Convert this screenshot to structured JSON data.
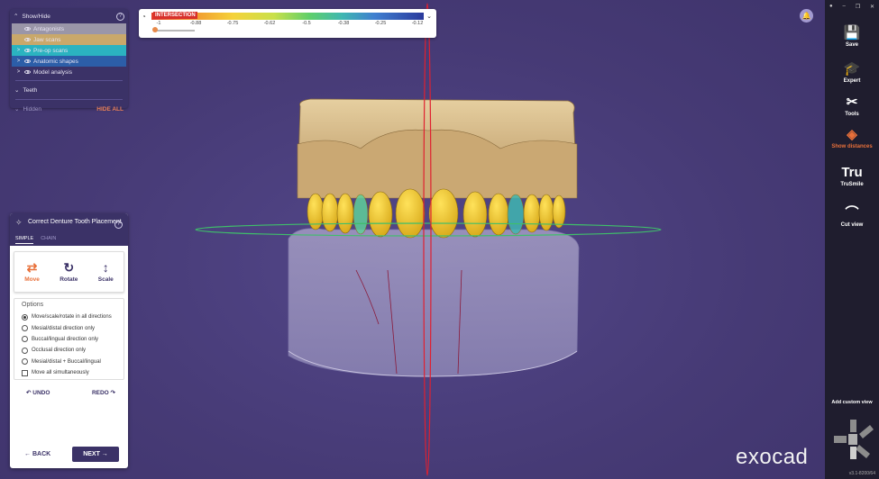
{
  "show_hide": {
    "title": "Show/Hide",
    "layers": [
      {
        "label": "Antagonists",
        "bg": "#9a96a8",
        "chevron": ""
      },
      {
        "label": "Jaw scans",
        "bg": "#c9a86a",
        "chevron": ""
      },
      {
        "label": "Pre-op scans",
        "bg": "#2bb3c0",
        "chevron": ">"
      },
      {
        "label": "Anatomic shapes",
        "bg": "#2c5ea8",
        "chevron": ">"
      },
      {
        "label": "Model analysis",
        "bg": "#3b3267",
        "chevron": ">"
      }
    ],
    "teeth_label": "Teeth",
    "hidden_label": "Hidden",
    "hide_all_label": "HIDE ALL"
  },
  "color_scale": {
    "title": "INTERSECTION",
    "ticks": [
      "-1",
      "-0.88",
      "-0.75",
      "-0.62",
      "-0.5",
      "-0.38",
      "-0.25",
      "-0.12"
    ]
  },
  "wizard": {
    "title": "Correct Denture Tooth Placement",
    "tabs": [
      "SIMPLE",
      "CHAIN"
    ],
    "tools": [
      {
        "label": "Move",
        "icon": "⇄",
        "active": true
      },
      {
        "label": "Rotate",
        "icon": "↻",
        "active": false
      },
      {
        "label": "Scale",
        "icon": "↕",
        "active": false
      }
    ],
    "options_title": "Options",
    "options": [
      {
        "label": "Move/scale/rotate in all directions",
        "selected": true
      },
      {
        "label": "Mesial/distal direction only",
        "selected": false
      },
      {
        "label": "Buccal/lingual direction only",
        "selected": false
      },
      {
        "label": "Occlusal direction only",
        "selected": false
      },
      {
        "label": "Mesial/distal + Buccal/lingual",
        "selected": false
      }
    ],
    "checkbox_label": "Move all simultaneously",
    "undo_label": "UNDO",
    "redo_label": "REDO",
    "back_label": "BACK",
    "next_label": "NEXT"
  },
  "toolbar": {
    "items": [
      {
        "label": "Save",
        "icon": "💾",
        "active": false
      },
      {
        "label": "Expert",
        "icon": "🎓",
        "active": false
      },
      {
        "label": "Tools",
        "icon": "✂",
        "active": false
      },
      {
        "label": "Show distances",
        "icon": "◈",
        "active": true
      },
      {
        "label": "TruSmile",
        "icon": "Tru",
        "active": false
      },
      {
        "label": "Cut view",
        "icon": "⌒",
        "active": false
      }
    ],
    "custom_view_label": "Add custom view",
    "version": "v3.1-8200/64"
  },
  "brand": "exocad",
  "colors": {
    "panel": "#3b3267",
    "accent": "#e8703a",
    "background": "#4a3f7a",
    "toolbar": "#1f1d2e"
  }
}
